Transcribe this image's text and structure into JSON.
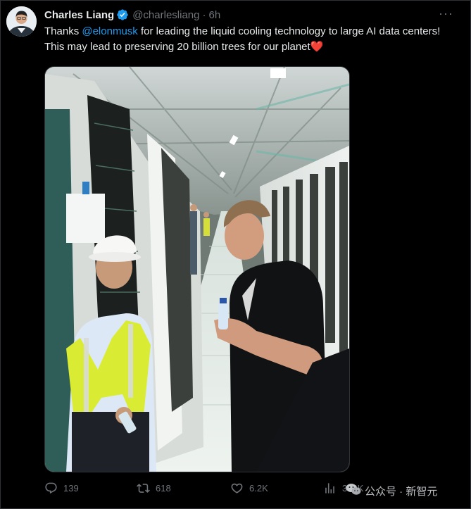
{
  "tweet": {
    "author": {
      "name": "Charles Liang",
      "handle": "@charlesliang",
      "time": "6h",
      "avatar_icon": "portrait-avatar",
      "verified_icon": "verified-badge-icon"
    },
    "text_parts": {
      "before": "Thanks ",
      "mention": "@elonmusk",
      "after": " for leading the liquid cooling technology to large AI data centers! This may lead to preserving 20 billion trees for our planet",
      "emoji": "❤️"
    },
    "more_label": "···",
    "photo_icon": "data-center-photo",
    "actions": {
      "replies": "139",
      "reposts": "618",
      "likes": "6.2K",
      "views": "330K"
    },
    "watermark": "公众号 · 新智元"
  },
  "colors": {
    "background": "#000000",
    "text": "#e7e9ea",
    "muted": "#71767b",
    "accent": "#1d9bf0",
    "heart": "#e0245e"
  }
}
